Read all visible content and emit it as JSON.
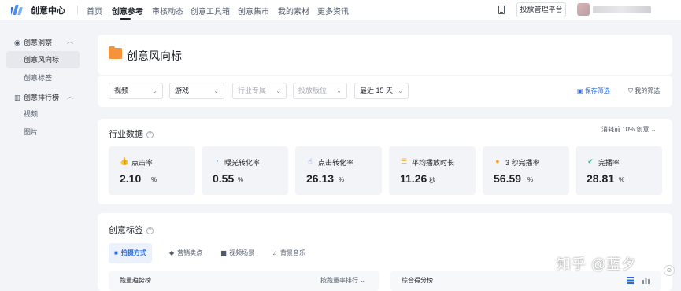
{
  "topnav": {
    "app_title": "创意中心",
    "items": [
      "首页",
      "创意参考",
      "审核动态",
      "创意工具箱",
      "创意集市",
      "我的素材",
      "更多资讯"
    ],
    "active_index": 1,
    "ad_platform_button": "投放管理平台"
  },
  "sidebar": {
    "group1": "创意洞察",
    "group1_items": [
      "创意风向标",
      "创意标签"
    ],
    "group2": "创意排行榜",
    "group2_items": [
      "视频",
      "图片"
    ],
    "active_item": "创意风向标"
  },
  "page": {
    "title": "创意风向标"
  },
  "filters": {
    "selects": [
      {
        "label": "视频",
        "placeholder": false
      },
      {
        "label": "游戏",
        "placeholder": false
      },
      {
        "label": "行业专属",
        "placeholder": true
      },
      {
        "label": "投放版位",
        "placeholder": true
      },
      {
        "label": "最近 15 天",
        "placeholder": false
      }
    ],
    "save_filter": "保存筛选",
    "my_filter": "我的筛选"
  },
  "industry": {
    "title": "行业数据",
    "consume_selector": "消耗前 10% 创意",
    "metrics": [
      {
        "label": "点击率",
        "value": "2.10",
        "unit": "%",
        "icon": "thumb-icon",
        "color": "#3b73e8"
      },
      {
        "label": "曝光转化率",
        "value": "0.55",
        "unit": "%",
        "icon": "target-icon",
        "color": "#3b9ae8"
      },
      {
        "label": "点击转化率",
        "value": "26.13",
        "unit": "%",
        "icon": "click-icon",
        "color": "#3b73e8"
      },
      {
        "label": "平均播放时长",
        "value": "11.26",
        "unit": "秒",
        "icon": "stack-icon",
        "color": "#f2b530"
      },
      {
        "label": "3 秒完播率",
        "value": "56.59",
        "unit": "%",
        "icon": "coin-icon",
        "color": "#f2a530"
      },
      {
        "label": "完播率",
        "value": "28.81",
        "unit": "%",
        "icon": "check-icon",
        "color": "#2fb39a"
      }
    ]
  },
  "tags": {
    "title": "创意标签",
    "tabs": [
      "拍摄方式",
      "营销卖点",
      "视频场景",
      "背景音乐"
    ],
    "active_tab": 0,
    "left_panel_label": "跑量趋势榜",
    "left_panel_sort": "按跑量率排行",
    "right_panel_label": "综合得分榜"
  },
  "watermark": "知乎 @蓝夕"
}
